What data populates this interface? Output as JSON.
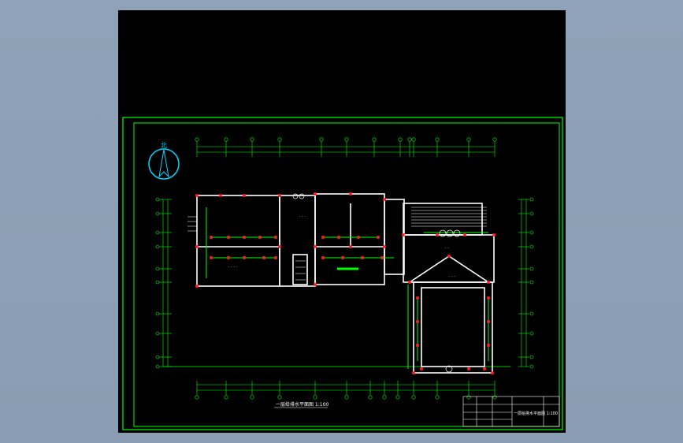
{
  "drawing": {
    "north_label": "北",
    "plan_title": "一层给排水平面图 1:100",
    "title_block_name": "一层给排水平面图 1:100"
  },
  "colors": {
    "background": "#000000",
    "frame": "#00ff00",
    "walls": "#ffffff",
    "pipes": "#00ff00",
    "fixtures": "#ff2020",
    "axis_bubbles": "#00ff00",
    "north_arrow": "#00d8ff"
  }
}
